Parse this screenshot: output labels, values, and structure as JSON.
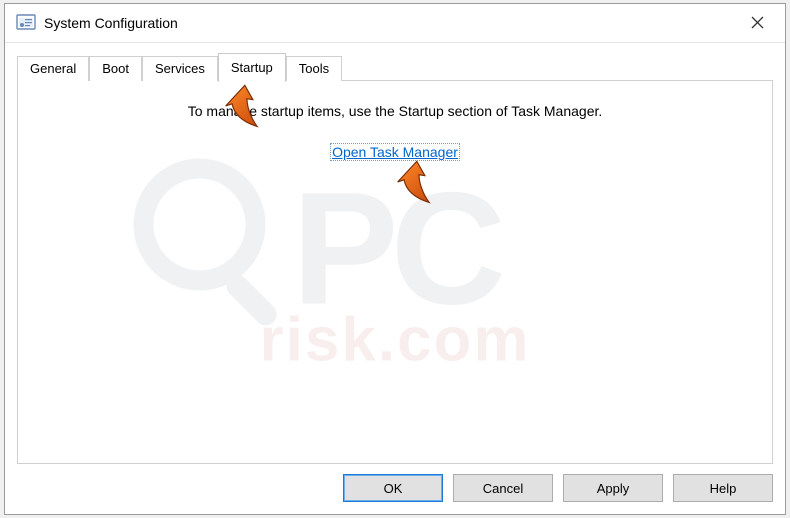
{
  "window": {
    "title": "System Configuration"
  },
  "tabs": {
    "general": "General",
    "boot": "Boot",
    "services": "Services",
    "startup": "Startup",
    "tools": "Tools"
  },
  "startup_panel": {
    "message": "To manage startup items, use the Startup section of Task Manager.",
    "link": "Open Task Manager"
  },
  "buttons": {
    "ok": "OK",
    "cancel": "Cancel",
    "apply": "Apply",
    "help": "Help"
  }
}
